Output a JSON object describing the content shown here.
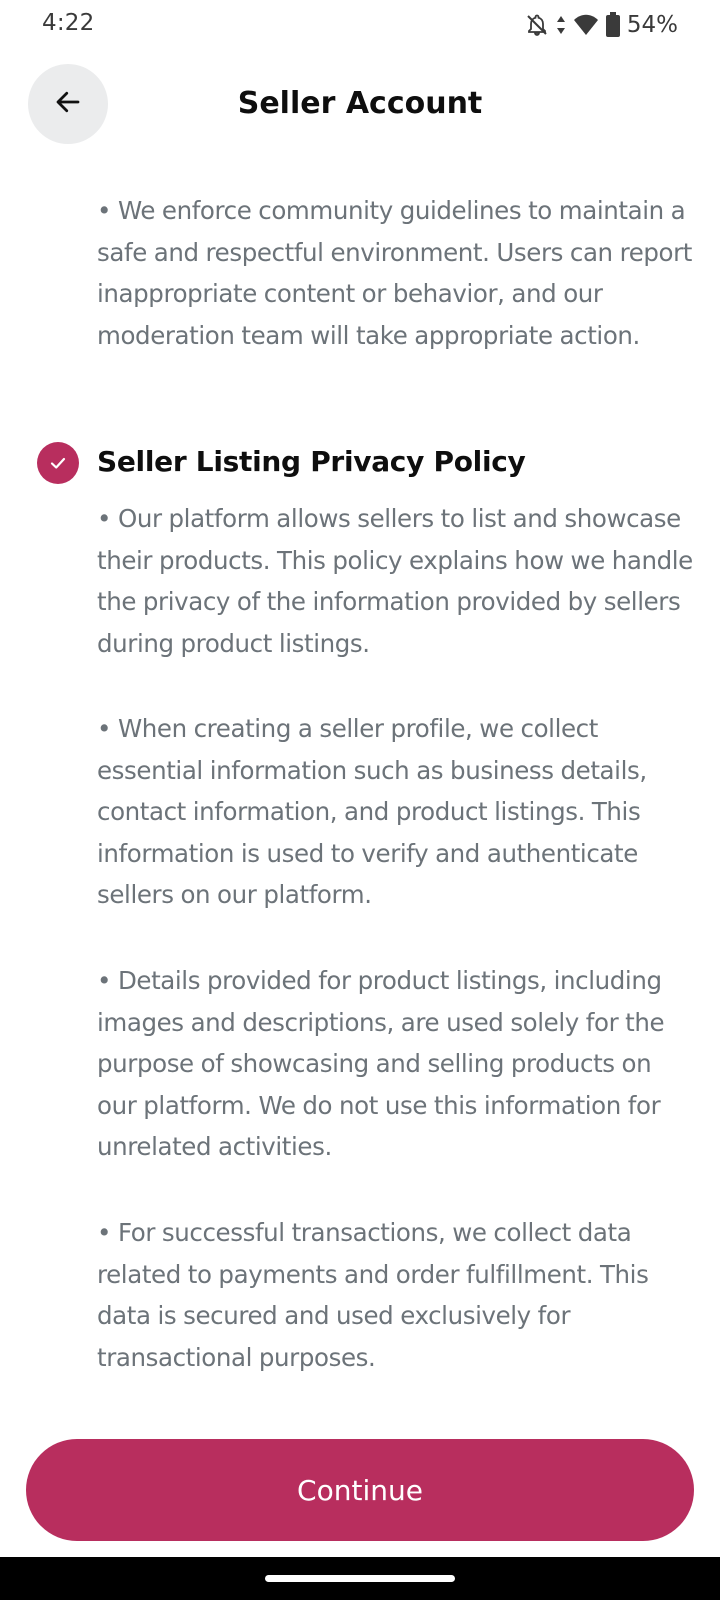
{
  "status_bar": {
    "time": "4:22",
    "battery_percent": "54%",
    "icons": [
      "bell-off-icon",
      "data-arrows-icon",
      "wifi-icon",
      "battery-icon"
    ]
  },
  "header": {
    "title": "Seller Account",
    "back_icon": "arrow-left-icon"
  },
  "content": {
    "intro_paragraph": "• We enforce community guidelines to maintain a safe and respectful environment. Users can report inappropriate content or behavior, and our moderation team will take appropriate action.",
    "section": {
      "heading": "Seller Listing Privacy Policy",
      "checked": true,
      "paragraphs": [
        "• Our platform allows sellers to list and showcase their products. This policy explains how we handle the privacy of the information provided by sellers during product listings.",
        "• When creating a seller profile, we collect essential information such as business details, contact information, and product listings. This information is used to verify and authenticate sellers on our platform.",
        "• Details provided for product listings, including images and descriptions, are used solely for the purpose of showcasing and selling products on our platform. We do not use this information for unrelated activities.",
        "• For successful transactions, we collect data related to payments and order fulfillment. This data is secured and used exclusively for transactional purposes."
      ]
    }
  },
  "footer": {
    "continue_label": "Continue"
  },
  "colors": {
    "accent": "#b82e5e",
    "body_text": "#6c7379",
    "heading_text": "#0e0e0e",
    "back_button_bg": "#ebeced"
  }
}
